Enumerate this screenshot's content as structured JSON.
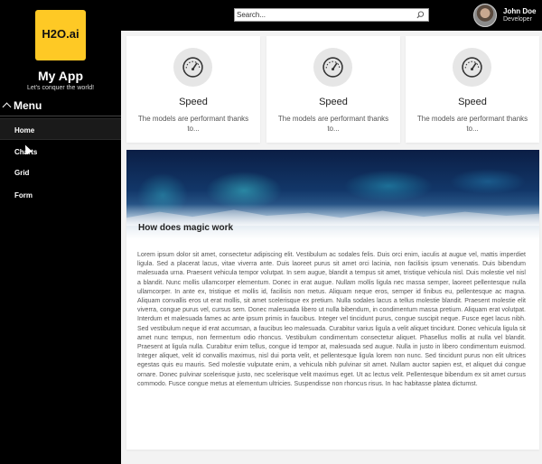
{
  "sidebar": {
    "logo_text": "H2O.ai",
    "app_title": "My App",
    "app_subtitle": "Let's conquer the world!",
    "menu_label": "Menu",
    "items": [
      {
        "label": "Home"
      },
      {
        "label": "Charts"
      },
      {
        "label": "Grid"
      },
      {
        "label": "Form"
      }
    ]
  },
  "header": {
    "search_placeholder": "Search...",
    "user_name": "John Doe",
    "user_role": "Developer"
  },
  "cards": [
    {
      "title": "Speed",
      "description": "The models are performant thanks to...",
      "icon": "speedometer-icon"
    },
    {
      "title": "Speed",
      "description": "The models are performant thanks to...",
      "icon": "speedometer-icon"
    },
    {
      "title": "Speed",
      "description": "The models are performant thanks to...",
      "icon": "speedometer-icon"
    }
  ],
  "article": {
    "title": "How does magic work",
    "body": "Lorem ipsum dolor sit amet, consectetur adipiscing elit. Vestibulum ac sodales felis. Duis orci enim, iaculis at augue vel, mattis imperdiet ligula. Sed a placerat lacus, vitae viverra ante. Duis laoreet purus sit amet orci lacinia, non facilisis ipsum venenatis. Duis bibendum malesuada urna. Praesent vehicula tempor volutpat. In sem augue, blandit a tempus sit amet, tristique vehicula nisl. Duis molestie vel nisl a blandit. Nunc mollis ullamcorper elementum. Donec in erat augue. Nullam mollis ligula nec massa semper, laoreet pellentesque nulla ullamcorper. In ante ex, tristique et mollis id, facilisis non metus. Aliquam neque eros, semper id finibus eu, pellentesque ac magna. Aliquam convallis eros ut erat mollis, sit amet scelerisque ex pretium. Nulla sodales lacus a tellus molestie blandit. Praesent molestie elit viverra, congue purus vel, cursus sem. Donec malesuada libero ut nulla bibendum, in condimentum massa pretium. Aliquam erat volutpat. Interdum et malesuada fames ac ante ipsum primis in faucibus. Integer vel tincidunt purus, congue suscipit neque. Fusce eget lacus nibh. Sed vestibulum neque id erat accumsan, a faucibus leo malesuada. Curabitur varius ligula a velit aliquet tincidunt. Donec vehicula ligula sit amet nunc tempus, non fermentum odio rhoncus. Vestibulum condimentum consectetur aliquet. Phasellus mollis at nulla vel blandit. Praesent at ligula nulla. Curabitur enim tellus, congue id tempor at, malesuada sed augue. Nulla in justo in libero condimentum euismod. Integer aliquet, velit id convallis maximus, nisl dui porta velit, et pellentesque ligula lorem non nunc. Sed tincidunt purus non elit ultrices egestas quis eu mauris. Sed molestie vulputate enim, a vehicula nibh pulvinar sit amet. Nullam auctor sapien est, et aliquet dui congue ornare. Donec pulvinar scelerisque justo, nec scelerisque velit maximus eget. Ut ac lectus velit. Pellentesque bibendum ex sit amet cursus commodo. Fusce congue metus at elementum ultricies. Suspendisse non rhoncus risus. In hac habitasse platea dictumst."
  },
  "colors": {
    "logo_bg": "#fec925",
    "sidebar_bg": "#000000",
    "page_bg": "#f3f3f3"
  }
}
